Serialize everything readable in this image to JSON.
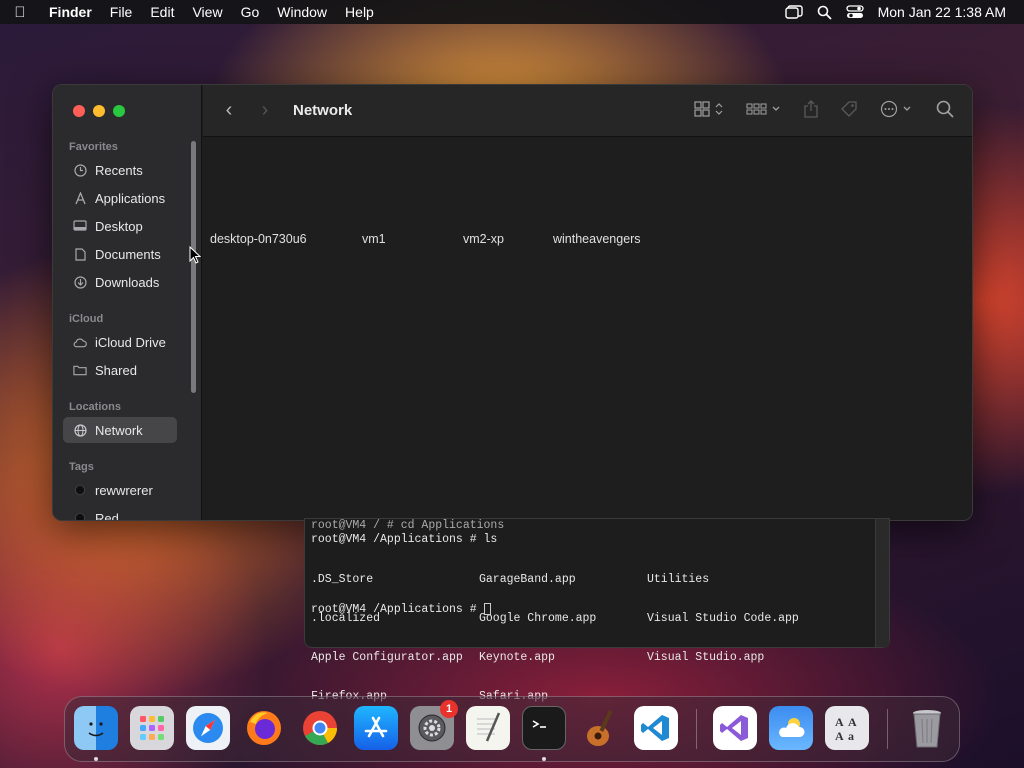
{
  "menubar": {
    "app": "Finder",
    "items": [
      "File",
      "Edit",
      "View",
      "Go",
      "Window",
      "Help"
    ],
    "datetime": "Mon Jan 22  1:38 AM"
  },
  "finder": {
    "title": "Network",
    "sidebar": {
      "favorites_label": "Favorites",
      "favorites": [
        "Recents",
        "Applications",
        "Desktop",
        "Documents",
        "Downloads"
      ],
      "icloud_label": "iCloud",
      "icloud": [
        "iCloud Drive",
        "Shared"
      ],
      "locations_label": "Locations",
      "locations": [
        "Network"
      ],
      "tags_label": "Tags",
      "tags": [
        "rewwrerer",
        "Red"
      ]
    },
    "items": [
      "desktop-0n730u6",
      "vm1",
      "vm2-xp",
      "wintheavengers"
    ]
  },
  "terminal": {
    "lines": [
      "root@VM4 / # cd Applications",
      "root@VM4 /Applications # ls"
    ],
    "col1": [
      ".DS_Store",
      ".localized",
      "Apple Configurator.app",
      "Firefox.app"
    ],
    "col2": [
      "GarageBand.app",
      "Google Chrome.app",
      "Keynote.app",
      "Safari.app"
    ],
    "col3": [
      "Utilities",
      "Visual Studio Code.app",
      "Visual Studio.app"
    ],
    "prompt": "root@VM4 /Applications # "
  },
  "dock": {
    "badge": "1",
    "apps": [
      "Finder",
      "Launchpad",
      "Safari",
      "Firefox",
      "Chrome",
      "App Store",
      "System Settings",
      "TextEdit",
      "Terminal",
      "GarageBand",
      "VS Code",
      "Visual Studio",
      "Weather",
      "Font Book",
      "Trash"
    ]
  },
  "colors": {
    "close": "#ff5f57",
    "minimize": "#febc2e",
    "zoom": "#28c840",
    "tag_rewwrerer": "#1a1a1a",
    "tag_red": "#1a1a1a"
  }
}
